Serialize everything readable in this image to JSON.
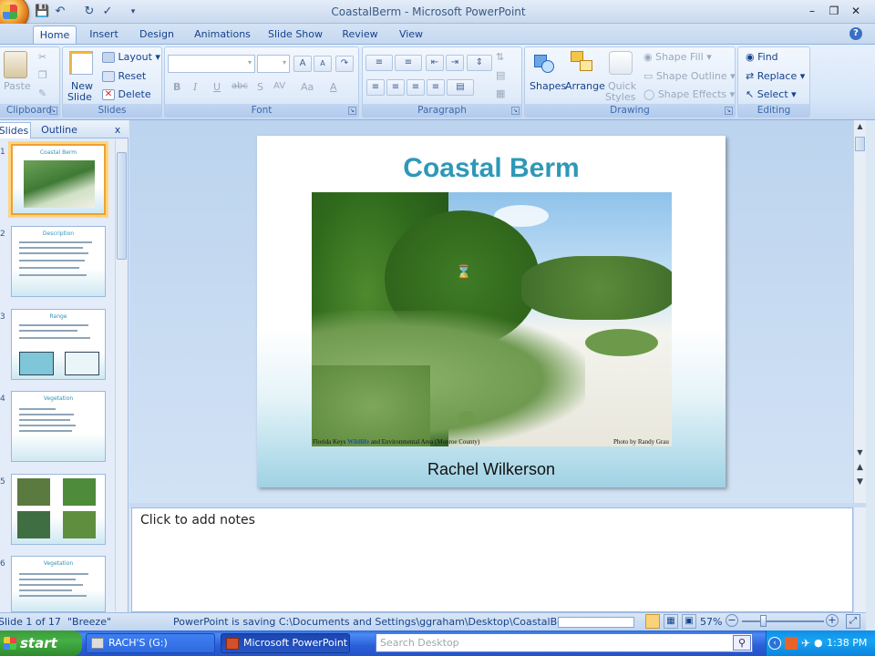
{
  "window": {
    "title": "CoastalBerm - Microsoft PowerPoint"
  },
  "tabs": [
    "Home",
    "Insert",
    "Design",
    "Animations",
    "Slide Show",
    "Review",
    "View"
  ],
  "ribbon": {
    "clipboard": {
      "label": "Clipboard",
      "paste": "Paste"
    },
    "slides": {
      "label": "Slides",
      "new_slide_1": "New",
      "new_slide_2": "Slide",
      "layout": "Layout",
      "reset": "Reset",
      "delete": "Delete"
    },
    "font": {
      "label": "Font",
      "bold": "B",
      "italic": "I",
      "underline": "U",
      "strike": "abc",
      "shadow": "S",
      "spacing": "AV",
      "case": "Aa",
      "color": "A",
      "grow": "A",
      "shrink": "A"
    },
    "paragraph": {
      "label": "Paragraph"
    },
    "drawing": {
      "label": "Drawing",
      "shapes": "Shapes",
      "arrange": "Arrange",
      "quick_1": "Quick",
      "quick_2": "Styles",
      "shape_fill": "Shape Fill",
      "shape_outline": "Shape Outline",
      "shape_effects": "Shape Effects"
    },
    "editing": {
      "label": "Editing",
      "find": "Find",
      "replace": "Replace",
      "select": "Select"
    }
  },
  "panel": {
    "tabs": [
      "Slides",
      "Outline"
    ],
    "close": "x"
  },
  "thumbnails": [
    {
      "num": "1",
      "title": "Coastal Berm"
    },
    {
      "num": "2",
      "title": "Description"
    },
    {
      "num": "3",
      "title": "Range"
    },
    {
      "num": "4",
      "title": "Vegetation"
    },
    {
      "num": "5",
      "title": ""
    },
    {
      "num": "6",
      "title": "Vegetation"
    }
  ],
  "slide": {
    "title": "Coastal Berm",
    "caption_left_1": "Florida Keys",
    "caption_left_highlight": "Wildlife",
    "caption_left_2": "and Environmental Area (Monroe County)",
    "caption_right": "Photo by Randy Grau",
    "subtitle": "Rachel Wilkerson"
  },
  "notes": {
    "placeholder": "Click to add notes"
  },
  "status": {
    "slide": "Slide 1 of 17",
    "theme": "\"Breeze\"",
    "message": "PowerPoint is saving C:\\Documents and Settings\\ggraham\\Desktop\\CoastalBerm.pptx.",
    "zoom": "57%",
    "zoom_minus": "−",
    "zoom_plus": "+"
  },
  "taskbar": {
    "start": "start",
    "items": [
      "RACH'S (G:)",
      "Microsoft PowerPoint ..."
    ],
    "search_placeholder": "Search Desktop",
    "clock": "1:38 PM"
  }
}
